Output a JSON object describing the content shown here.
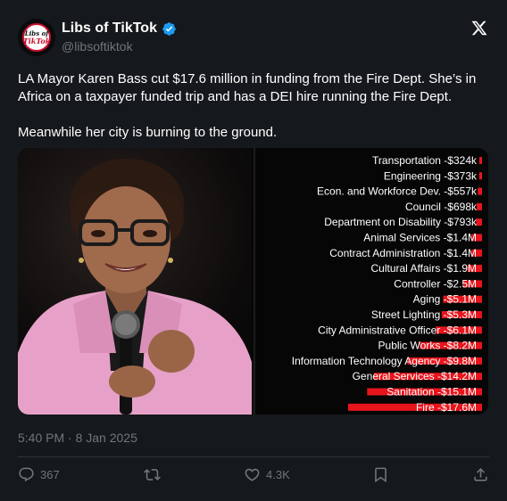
{
  "tweet": {
    "author_name": "Libs of TikTok",
    "author_handle": "@libsoftiktok",
    "avatar_text_1": "Libs of",
    "avatar_text_2": "TikTok",
    "text_paragraph_1": "LA Mayor Karen Bass cut $17.6 million in funding from the Fire Dept. She’s in Africa on a taxpayer funded trip and has a DEI hire running the Fire Dept.",
    "text_paragraph_2": "Meanwhile her city is burning to the ground.",
    "timestamp": "5:40 PM · 8 Jan 2025",
    "replies": "367",
    "likes": "4.3K"
  },
  "colors": {
    "background": "#15181c",
    "verified_blue": "#1d9bf0",
    "bar_red": "#e8141c",
    "secondary_text": "#71767b",
    "blazer_pink": "#e7a1c8"
  },
  "icons": [
    "verified-badge-icon",
    "x-logo-icon",
    "reply-icon",
    "retweet-icon",
    "like-icon",
    "bookmark-icon",
    "share-icon"
  ],
  "chart_data": {
    "type": "bar",
    "orientation": "horizontal",
    "unit": "$M",
    "categories": [
      "Transportation",
      "Engineering",
      "Econ. and Workforce Dev.",
      "Council",
      "Department on Disability",
      "Animal Services",
      "Contract Administration",
      "Cultural Affairs",
      "Controller",
      "Aging",
      "Street Lighting",
      "City Administrative Officer",
      "Public Works",
      "Information Technology Agency",
      "General Services",
      "Sanitation",
      "Fire"
    ],
    "value_labels": [
      "-$324k",
      "-$373k",
      "-$557k",
      "-$698k",
      "-$793k",
      "-$1.4M",
      "-$1.4M",
      "-$1.9M",
      "-$2.5M",
      "-$5.1M",
      "-$5.3M",
      "-$6.1M",
      "-$8.2M",
      "-$9.8M",
      "-$14.2M",
      "-$15.1M",
      "-$17.6M"
    ],
    "values": [
      0.324,
      0.373,
      0.557,
      0.698,
      0.793,
      1.4,
      1.4,
      1.9,
      2.5,
      5.1,
      5.3,
      6.1,
      8.2,
      9.8,
      14.2,
      15.1,
      17.6
    ]
  }
}
